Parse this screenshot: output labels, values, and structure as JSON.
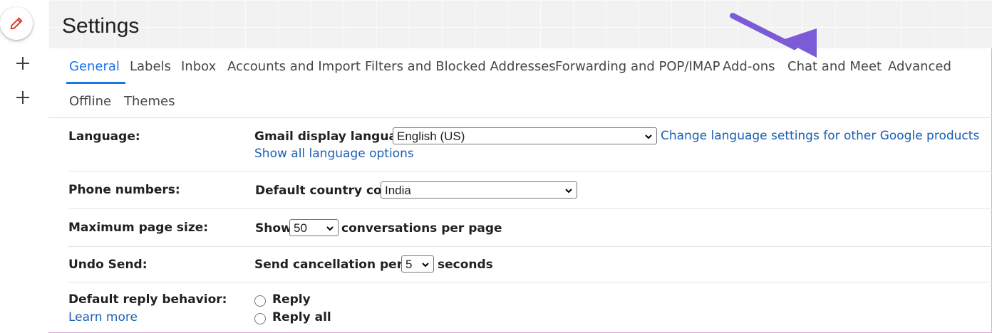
{
  "page": {
    "title": "Settings"
  },
  "tabs": {
    "row1": [
      "General",
      "Labels",
      "Inbox",
      "Accounts and Import",
      "Filters and Blocked Addresses",
      "Forwarding and POP/IMAP",
      "Add-ons",
      "Chat and Meet",
      "Advanced"
    ],
    "row2": [
      "Offline",
      "Themes"
    ],
    "active": "General"
  },
  "settings": {
    "language": {
      "label": "Language:",
      "field_label": "Gmail display language:",
      "value": "English (US)",
      "link": "Change language settings for other Google products",
      "show_all": "Show all language options"
    },
    "phone": {
      "label": "Phone numbers:",
      "field_label": "Default country code:",
      "value": "India"
    },
    "page_size": {
      "label": "Maximum page size:",
      "prefix": "Show",
      "value": "50",
      "suffix": "conversations per page"
    },
    "undo": {
      "label": "Undo Send:",
      "field_label": "Send cancellation period:",
      "value": "5",
      "suffix": "seconds"
    },
    "reply": {
      "label": "Default reply behavior:",
      "learn_more": "Learn more",
      "options": [
        "Reply",
        "Reply all"
      ]
    }
  },
  "colors": {
    "accent": "#1a73e8",
    "link": "#1a5fb4",
    "annotation_arrow": "#7b5cd6"
  },
  "icons": {
    "compose": "pencil-icon",
    "add": "plus-icon",
    "dropdown": "chevron-down-icon"
  }
}
